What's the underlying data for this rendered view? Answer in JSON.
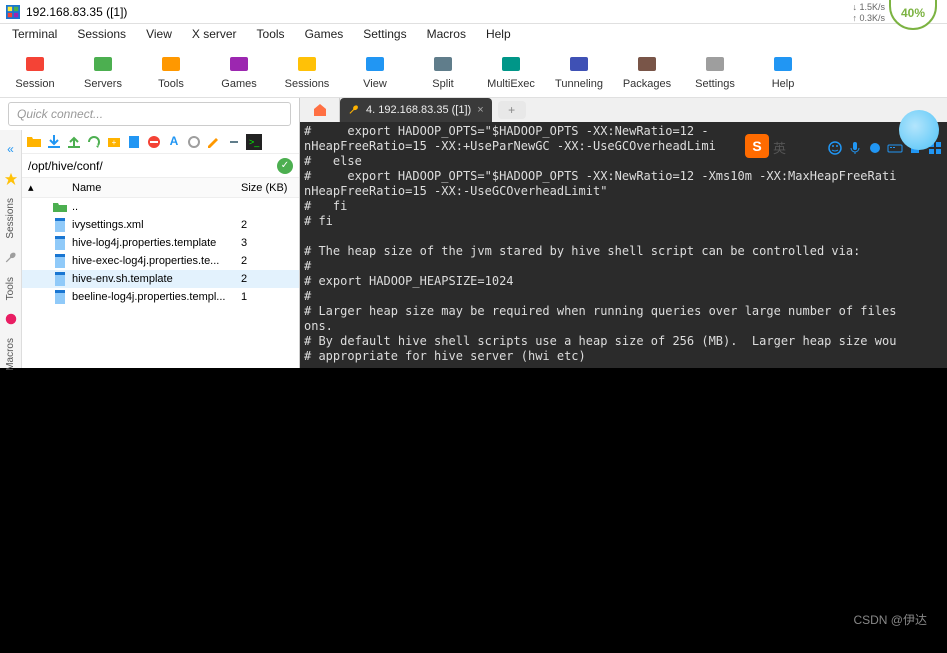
{
  "title": "192.168.83.35 ([1])",
  "cpu_percent": "40%",
  "kbps_up": "1.5K/s",
  "kbps_down": "0.3K/s",
  "menu": [
    "Terminal",
    "Sessions",
    "View",
    "X server",
    "Tools",
    "Games",
    "Settings",
    "Macros",
    "Help"
  ],
  "toolbar": [
    {
      "label": "Session",
      "color": "#f44336"
    },
    {
      "label": "Servers",
      "color": "#4caf50"
    },
    {
      "label": "Tools",
      "color": "#ff9800"
    },
    {
      "label": "Games",
      "color": "#9c27b0"
    },
    {
      "label": "Sessions",
      "color": "#ffc107"
    },
    {
      "label": "View",
      "color": "#2196f3"
    },
    {
      "label": "Split",
      "color": "#607d8b"
    },
    {
      "label": "MultiExec",
      "color": "#009688"
    },
    {
      "label": "Tunneling",
      "color": "#3f51b5"
    },
    {
      "label": "Packages",
      "color": "#795548"
    },
    {
      "label": "Settings",
      "color": "#9e9e9e"
    },
    {
      "label": "Help",
      "color": "#2196f3"
    }
  ],
  "quick_connect_placeholder": "Quick connect...",
  "side_tabs": [
    "Sessions",
    "Tools",
    "Macros"
  ],
  "path": "/opt/hive/conf/",
  "file_header": {
    "name": "Name",
    "size": "Size (KB)"
  },
  "files": [
    {
      "name": "..",
      "size": "",
      "type": "up"
    },
    {
      "name": "ivysettings.xml",
      "size": "2",
      "type": "file"
    },
    {
      "name": "hive-log4j.properties.template",
      "size": "3",
      "type": "file"
    },
    {
      "name": "hive-exec-log4j.properties.te...",
      "size": "2",
      "type": "file"
    },
    {
      "name": "hive-env.sh.template",
      "size": "2",
      "type": "file",
      "selected": true
    },
    {
      "name": "beeline-log4j.properties.templ...",
      "size": "1",
      "type": "file"
    }
  ],
  "tab": {
    "title": "4. 192.168.83.35 ([1])"
  },
  "terminal_text": "#     export HADOOP_OPTS=\"$HADOOP_OPTS -XX:NewRatio=12 -\nnHeapFreeRatio=15 -XX:+UseParNewGC -XX:-UseGCOverheadLimi\n#   else\n#     export HADOOP_OPTS=\"$HADOOP_OPTS -XX:NewRatio=12 -Xms10m -XX:MaxHeapFreeRati\nnHeapFreeRatio=15 -XX:-UseGCOverheadLimit\"\n#   fi\n# fi\n\n# The heap size of the jvm stared by hive shell script can be controlled via:\n#\n# export HADOOP_HEAPSIZE=1024\n#\n# Larger heap size may be required when running queries over large number of files\nons.\n# By default hive shell scripts use a heap size of 256 (MB).  Larger heap size wou\n# appropriate for hive server (hwi etc)",
  "overlay_letter": "S",
  "overlay_cn": "英",
  "watermark": "CSDN @伊达"
}
